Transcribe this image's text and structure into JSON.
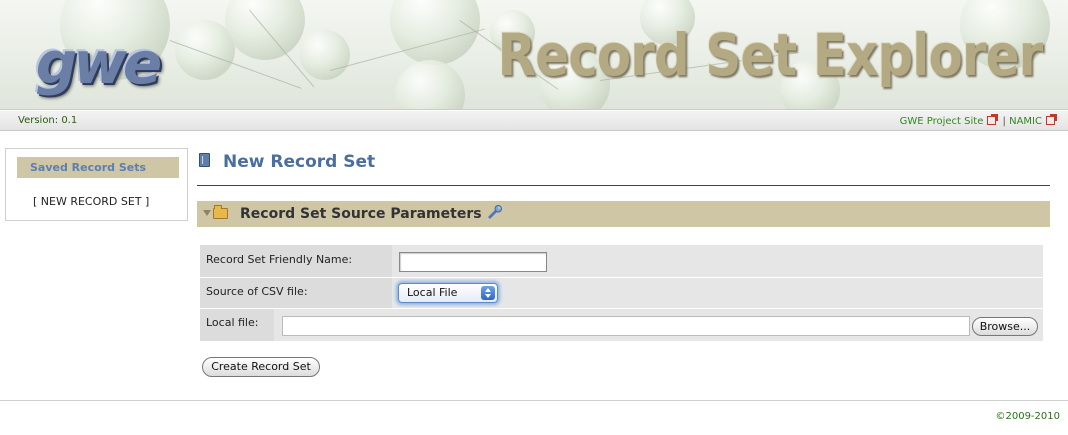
{
  "header": {
    "logo_text": "gwe",
    "app_title": "Record Set Explorer"
  },
  "version_bar": {
    "version": "Version: 0.1",
    "links": [
      {
        "label": "GWE Project Site",
        "icon": "external-link-icon"
      },
      {
        "label": "NAMIC",
        "icon": "external-link-icon"
      }
    ],
    "separator": "|"
  },
  "sidebar": {
    "heading": "Saved Record Sets",
    "items": [
      {
        "label": "[ NEW RECORD SET ]"
      }
    ]
  },
  "main": {
    "page_title": "New Record Set",
    "page_title_icon": "book-icon",
    "section": {
      "title": "Record Set Source Parameters",
      "toggle_icon": "collapse-arrow-icon",
      "folder_icon": "open-folder-icon",
      "action_icon": "wrench-icon"
    },
    "form": {
      "friendly_name": {
        "label": "Record Set Friendly Name:",
        "value": "",
        "placeholder": ""
      },
      "csv_source": {
        "label": "Source of CSV file:",
        "selected": "Local File"
      },
      "local_file": {
        "label": "Local file:",
        "value": "",
        "browse_label": "Browse..."
      }
    },
    "submit_label": "Create Record Set"
  },
  "footer": {
    "copyright": "©2009-2010"
  },
  "colors": {
    "section_bar": "#cfc6a6",
    "title_blue": "#4a6f9e",
    "link_green": "#2e8a1c"
  }
}
